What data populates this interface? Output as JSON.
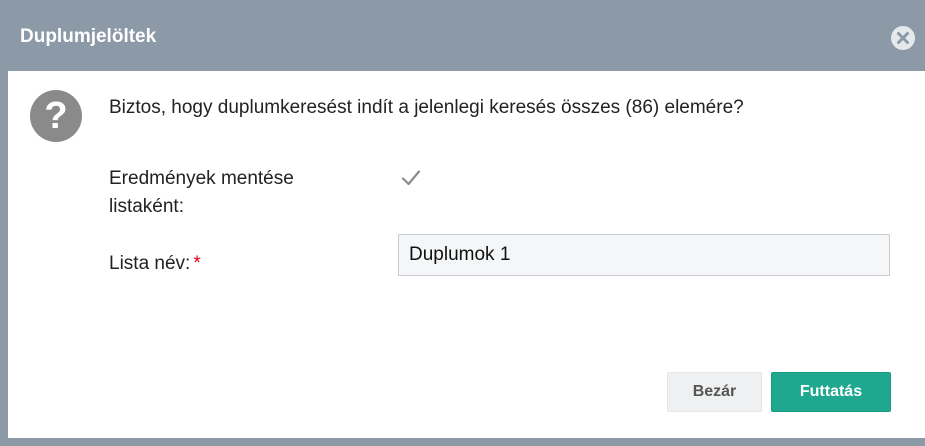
{
  "dialog": {
    "title": "Duplumjelöltek",
    "message": "Biztos, hogy duplumkeresést indít a jelenlegi keresés összes (86) elemére?",
    "save_as_list_label": "Eredmények mentése listaként:",
    "save_as_list_checked": true,
    "list_name_label": "Lista név:",
    "required_marker": "*",
    "list_name_value": "Duplumok 1",
    "buttons": {
      "close_label": "Bezár",
      "run_label": "Futtatás"
    }
  },
  "icons": {
    "close": "close-circle-icon",
    "question": "question-icon",
    "checkbox": "checkmark-icon"
  },
  "colors": {
    "titlebar": "#8b9aa6",
    "primary_button": "#1fa88f",
    "required": "#e0001b"
  }
}
